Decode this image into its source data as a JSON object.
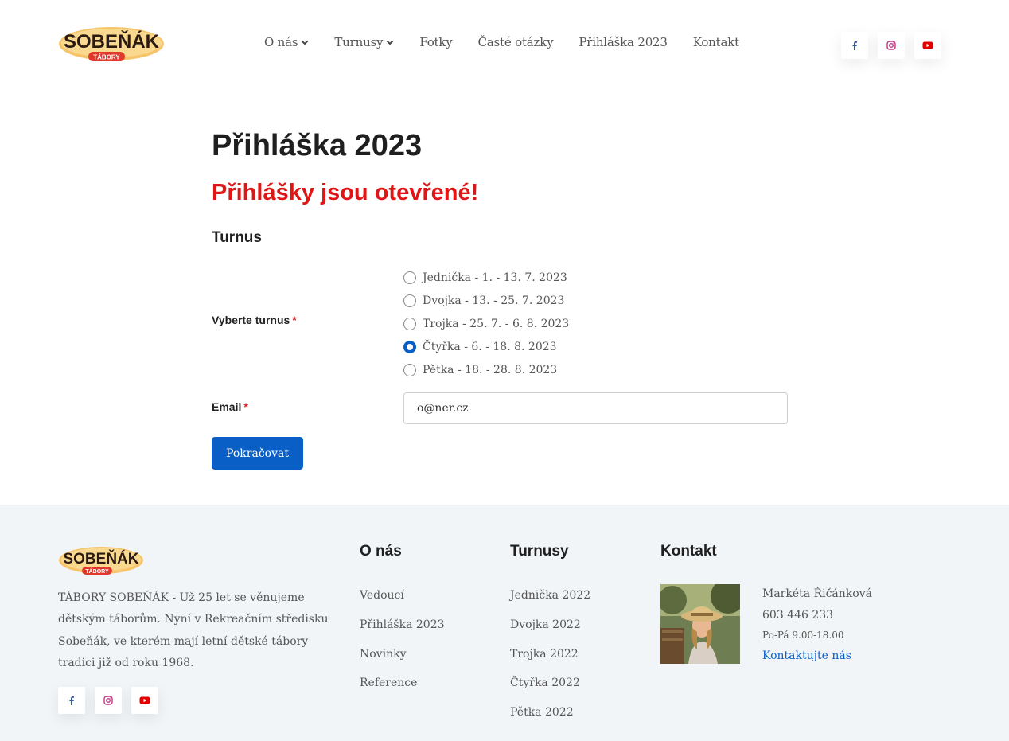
{
  "header": {
    "logo": {
      "brand": "SOBEŇÁK",
      "sub": "TÁBORY"
    },
    "nav": [
      {
        "label": "O nás",
        "has_dropdown": true
      },
      {
        "label": "Turnusy",
        "has_dropdown": true
      },
      {
        "label": "Fotky",
        "has_dropdown": false
      },
      {
        "label": "Časté otázky",
        "has_dropdown": false
      },
      {
        "label": "Přihláška 2023",
        "has_dropdown": false
      },
      {
        "label": "Kontakt",
        "has_dropdown": false
      }
    ],
    "social": [
      "facebook-icon",
      "instagram-icon",
      "youtube-icon"
    ]
  },
  "main": {
    "title": "Přihláška 2023",
    "open_note": "Přihlášky jsou otevřené!",
    "section_title": "Turnus",
    "turnus_label": "Vyberte turnus",
    "required_mark": "*",
    "turnus_options": [
      {
        "label": "Jednička - 1. - 13. 7. 2023",
        "checked": false
      },
      {
        "label": "Dvojka - 13. - 25. 7. 2023",
        "checked": false
      },
      {
        "label": "Trojka - 25. 7. - 6. 8. 2023",
        "checked": false
      },
      {
        "label": "Čtyřka - 6. - 18. 8. 2023",
        "checked": true
      },
      {
        "label": "Pětka - 18. - 28. 8. 2023",
        "checked": false
      }
    ],
    "email_label": "Email",
    "email_value": "o@ner.cz",
    "submit_label": "Pokračovat"
  },
  "footer": {
    "logo": {
      "brand": "SOBEŇÁK",
      "sub": "TÁBORY"
    },
    "about": "TÁBORY SOBEŇÁK - Už 25 let se věnujeme dětským táborům. Nyní v Rekreačním středisku Sobeňák, ve kterém mají letní dětské tábory tradici již od roku 1968.",
    "columns": {
      "o_nas": {
        "title": "O nás",
        "links": [
          "Vedoucí",
          "Přihláška 2023",
          "Novinky",
          "Reference"
        ]
      },
      "turnusy": {
        "title": "Turnusy",
        "links": [
          "Jednička 2022",
          "Dvojka 2022",
          "Trojka 2022",
          "Čtyřka 2022",
          "Pětka 2022"
        ]
      },
      "kontakt": {
        "title": "Kontakt",
        "name": "Markéta Řičánková",
        "phone": "603 446 233",
        "hours": "Po-Pá 9.00-18.00",
        "link": "Kontaktujte nás"
      }
    }
  },
  "colors": {
    "accent": "#0a5fc7",
    "alert": "#e01616",
    "footer_bg": "#f2f5f8",
    "facebook": "#3b5998",
    "instagram": "#c13584",
    "youtube": "#e00000"
  }
}
